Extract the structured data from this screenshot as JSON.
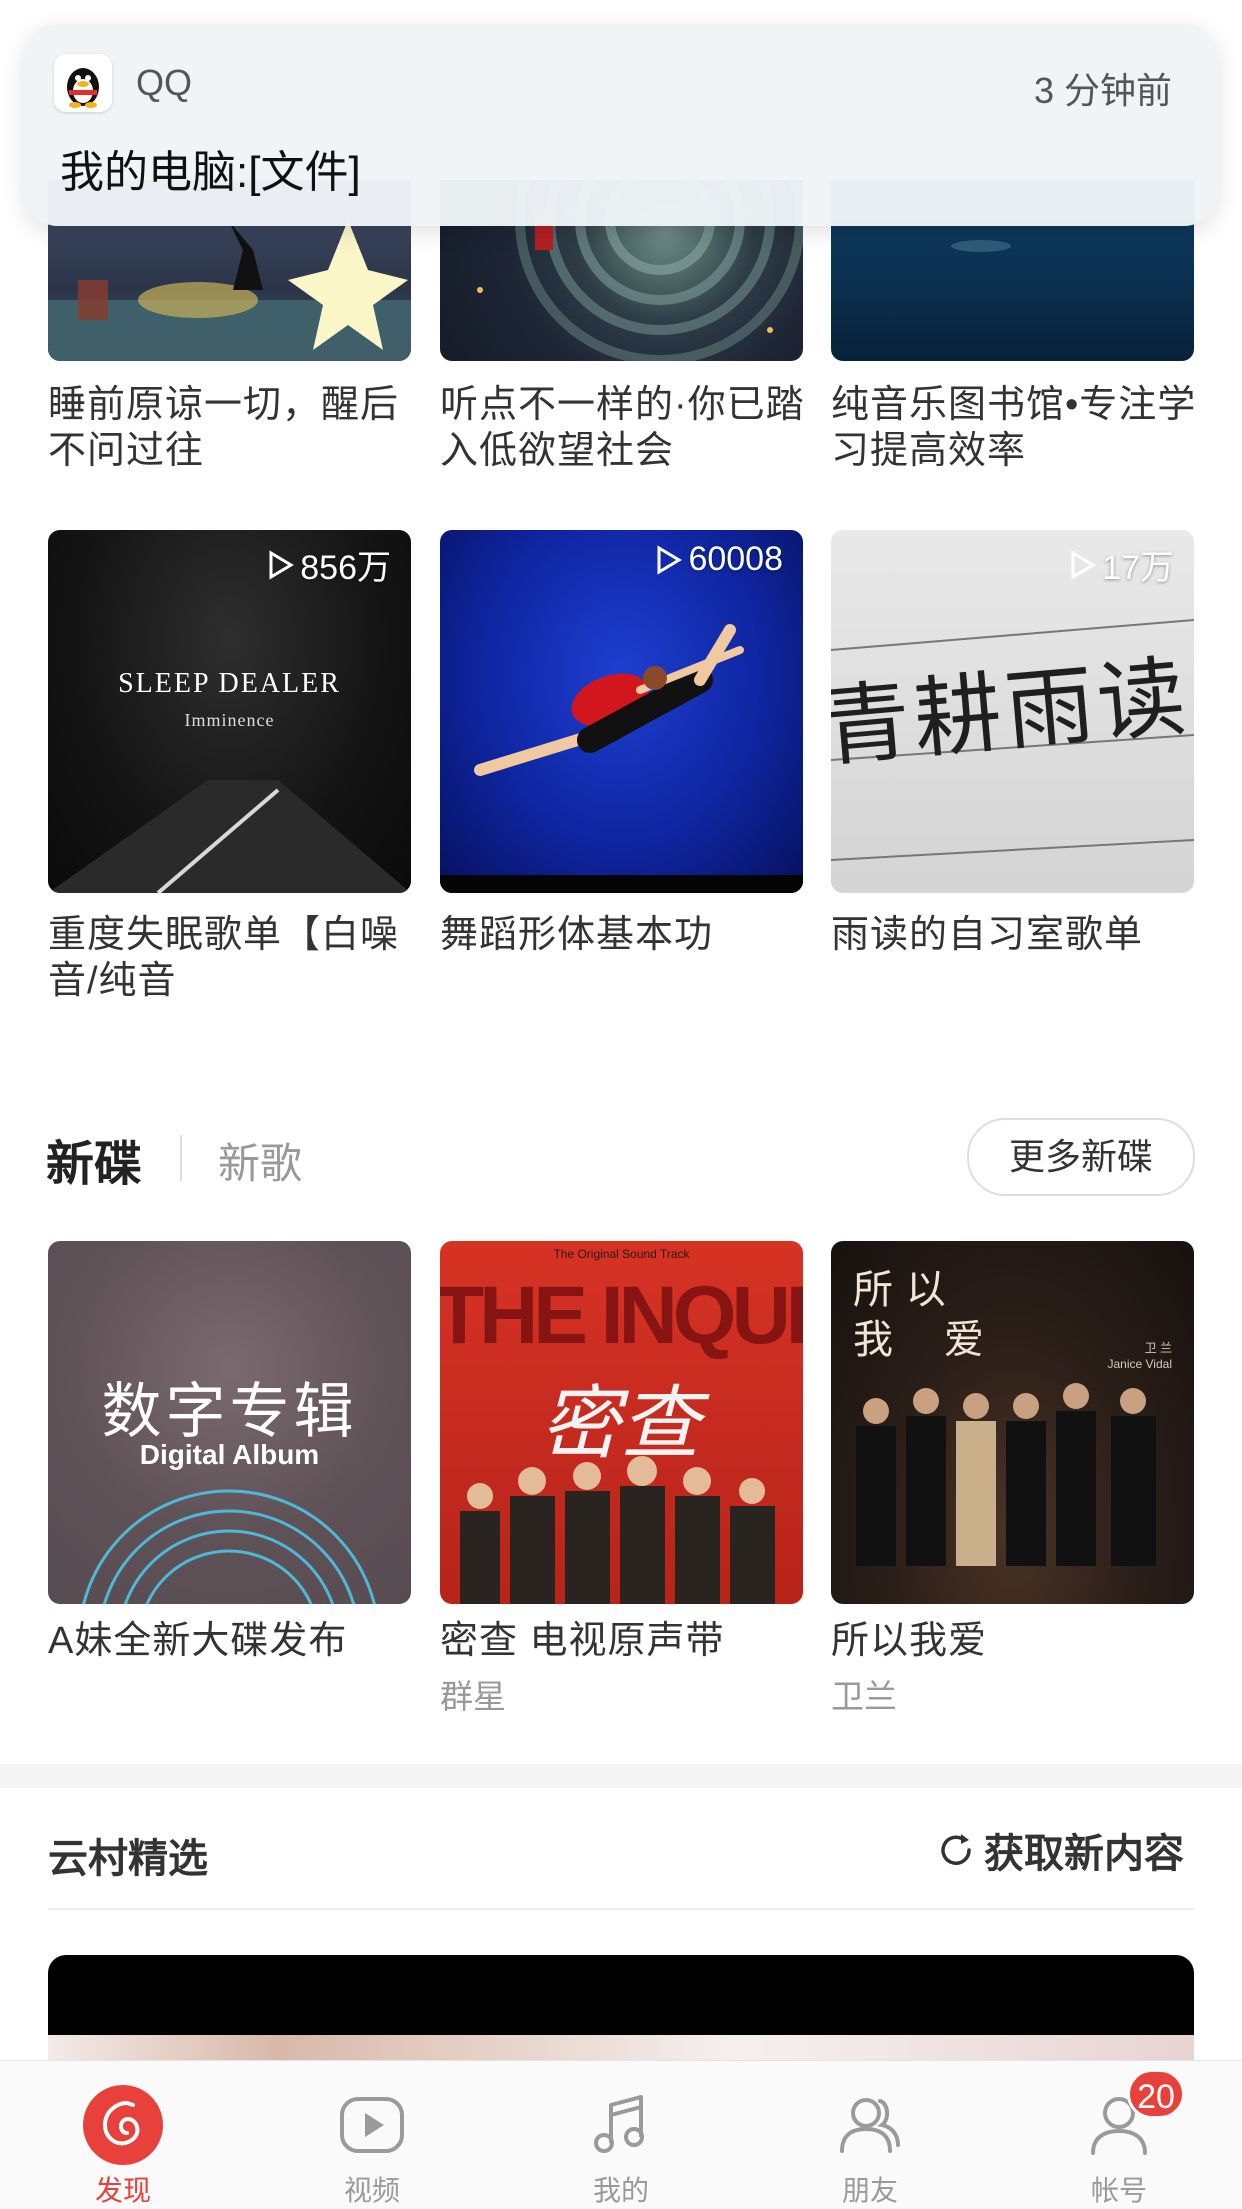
{
  "notification": {
    "app": "QQ",
    "time": "3 分钟前",
    "message": "我的电脑:[文件]"
  },
  "playlists_top": [
    {
      "title": "睡前原谅一切，醒后不问过往"
    },
    {
      "title": "听点不一样的·你已踏入低欲望社会"
    },
    {
      "title": "纯音乐图书馆•专注学习提高效率"
    }
  ],
  "playlists_mid": [
    {
      "title": "重度失眠歌单【白噪音/纯音",
      "plays": "856万",
      "cover_line1": "SLEEP DEALER",
      "cover_line2": "Imminence"
    },
    {
      "title": "舞蹈形体基本功",
      "plays": "60008"
    },
    {
      "title": "雨读的自习室歌单",
      "plays": "17万",
      "cover_text": "青耕雨读"
    }
  ],
  "new_albums": {
    "tab_active": "新碟",
    "tab_inactive": "新歌",
    "more_button": "更多新碟",
    "items": [
      {
        "title": "A妹全新大碟发布",
        "artist": "",
        "cover_line1": "数字专辑",
        "cover_line2": "Digital Album"
      },
      {
        "title": "密查 电视原声带",
        "artist": "群星",
        "cover_top": "The Original Sound Track",
        "cover_big": "THE INQUIRY IN",
        "cover_title": "密查"
      },
      {
        "title": "所以我爱",
        "artist": "卫兰",
        "cover_text1": "所 以",
        "cover_text2": "我    爱",
        "cover_name": "卫 兰",
        "cover_en": "Janice Vidal"
      }
    ]
  },
  "yuncun": {
    "title": "云村精选",
    "refresh": "获取新内容"
  },
  "tabs": [
    {
      "label": "发现",
      "icon": "netease-logo-icon",
      "active": true
    },
    {
      "label": "视频",
      "icon": "video-play-icon",
      "active": false
    },
    {
      "label": "我的",
      "icon": "music-note-icon",
      "active": false
    },
    {
      "label": "朋友",
      "icon": "friends-icon",
      "active": false
    },
    {
      "label": "帐号",
      "icon": "account-icon",
      "active": false,
      "badge": "20"
    }
  ],
  "colors": {
    "accent": "#e8403b",
    "badge": "#e8403b",
    "inactive_tab": "#9a9a9a"
  }
}
